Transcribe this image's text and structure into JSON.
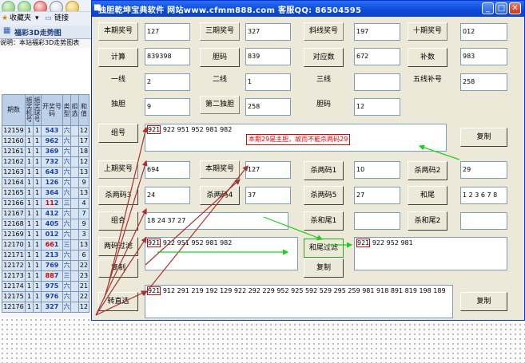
{
  "browser": {
    "favorites_label": "收藏夹",
    "links_label": "链接",
    "tab_title": "福彩3D走势图",
    "description": "说明：本站福彩3D走势图表"
  },
  "table": {
    "headers": [
      "期数",
      "摇奖机号",
      "摇奖球号",
      "开奖号码",
      "类型",
      "组选",
      "和值"
    ],
    "rows": [
      {
        "issue": "12159",
        "machine": "1",
        "ball": "1",
        "d1": "5",
        "d2": "4",
        "d3": "3",
        "type": "六",
        "sum": "12"
      },
      {
        "issue": "12160",
        "machine": "1",
        "ball": "1",
        "d1": "9",
        "d2": "6",
        "d3": "2",
        "type": "六",
        "sum": "17"
      },
      {
        "issue": "12161",
        "machine": "1",
        "ball": "1",
        "d1": "3",
        "d2": "6",
        "d3": "9",
        "type": "六",
        "sum": "18"
      },
      {
        "issue": "12162",
        "machine": "1",
        "ball": "1",
        "d1": "7",
        "d2": "3",
        "d3": "2",
        "type": "六",
        "sum": "12"
      },
      {
        "issue": "12163",
        "machine": "1",
        "ball": "1",
        "d1": "6",
        "d2": "4",
        "d3": "3",
        "type": "六",
        "sum": "13"
      },
      {
        "issue": "12164",
        "machine": "1",
        "ball": "1",
        "d1": "1",
        "d2": "2",
        "d3": "6",
        "type": "六",
        "sum": "9"
      },
      {
        "issue": "12165",
        "machine": "1",
        "ball": "1",
        "d1": "3",
        "d2": "6",
        "d3": "4",
        "type": "六",
        "sum": "13"
      },
      {
        "issue": "12166",
        "machine": "1",
        "ball": "1",
        "d1": "1",
        "d2": "1",
        "d3": "2",
        "type": "三",
        "sum": "4"
      },
      {
        "issue": "12167",
        "machine": "1",
        "ball": "1",
        "d1": "4",
        "d2": "1",
        "d3": "2",
        "type": "六",
        "sum": "7"
      },
      {
        "issue": "12168",
        "machine": "1",
        "ball": "1",
        "d1": "4",
        "d2": "0",
        "d3": "5",
        "type": "六",
        "sum": "9"
      },
      {
        "issue": "12169",
        "machine": "1",
        "ball": "1",
        "d1": "0",
        "d2": "1",
        "d3": "2",
        "type": "六",
        "sum": "3"
      },
      {
        "issue": "12170",
        "machine": "1",
        "ball": "1",
        "d1": "6",
        "d2": "6",
        "d3": "1",
        "type": "三",
        "sum": "13"
      },
      {
        "issue": "12171",
        "machine": "1",
        "ball": "1",
        "d1": "2",
        "d2": "1",
        "d3": "3",
        "type": "六",
        "sum": "6"
      },
      {
        "issue": "12172",
        "machine": "1",
        "ball": "1",
        "d1": "7",
        "d2": "6",
        "d3": "9",
        "type": "六",
        "sum": "22"
      },
      {
        "issue": "12173",
        "machine": "1",
        "ball": "1",
        "d1": "8",
        "d2": "8",
        "d3": "7",
        "type": "三",
        "sum": "23"
      },
      {
        "issue": "12174",
        "machine": "1",
        "ball": "1",
        "d1": "9",
        "d2": "7",
        "d3": "5",
        "type": "六",
        "sum": "21"
      },
      {
        "issue": "12175",
        "machine": "1",
        "ball": "1",
        "d1": "9",
        "d2": "7",
        "d3": "6",
        "type": "六",
        "sum": "22"
      },
      {
        "issue": "12176",
        "machine": "1",
        "ball": "1",
        "d1": "3",
        "d2": "2",
        "d3": "7",
        "type": "六",
        "sum": "12"
      }
    ]
  },
  "window": {
    "title": "独胆乾坤宝典软件    网站www.cfmm888.com    客服QQ: 86504595"
  },
  "labels": {
    "last_issue": "本期奖号",
    "third_issue": "三期奖号",
    "diagonal": "斜线奖号",
    "tenth_issue": "十期奖号",
    "yixian": "一线",
    "erxian": "二线",
    "sanxian": "三线",
    "wuxian_bu": "五线补号",
    "dudan": "独胆",
    "second_dudan": "第二独胆",
    "danma": "胆码",
    "prev_issue": "上期奖号",
    "current_issue": "本期奖号"
  },
  "buttons": {
    "calc": "计算",
    "danma": "胆码",
    "duizhao": "对应数",
    "bushu": "补数",
    "zuhao": "组号",
    "copy": "复制",
    "kill_two_1": "杀两码1",
    "kill_two_2": "杀两码2",
    "kill_two_3": "杀两码3",
    "kill_two_4": "杀两码4",
    "kill_two_5": "杀两码5",
    "hewei": "和尾",
    "zuhe": "组合",
    "kill_hewei_1": "杀和尾1",
    "kill_hewei_2": "杀和尾2",
    "two_filter": "两码过滤",
    "hewei_filter": "和尾过滤",
    "zhuan_zhixuan": "转直选"
  },
  "values": {
    "last_issue": "127",
    "third_issue": "327",
    "diagonal": "197",
    "tenth_issue": "012",
    "calc_result": "839398",
    "danma_result": "839",
    "duizhao_result": "672",
    "bushu_result": "983",
    "yixian": "2",
    "erxian": "1",
    "sanxian": "",
    "wuxian_bu": "258",
    "dudan": "9",
    "second_dudan": "258",
    "danma": "12",
    "prev_issue": "694",
    "current_issue": "127",
    "kill_two_1": "10",
    "kill_two_2": "29",
    "kill_two_3": "24",
    "kill_two_4": "37",
    "kill_two_5": "27",
    "hewei": "1 2 3 6 7 8",
    "zuhe": "18 24 37 27",
    "kill_hewei_1": "",
    "kill_hewei_2": "",
    "zuhao_first": "921",
    "zuhao_rest": "922 951 952 981 982",
    "filter_first": "921",
    "filter_rest": "922 951 952 981 982",
    "hewei_first": "921",
    "hewei_rest": "922 952 981",
    "zhixuan_first": "921",
    "zhixuan_rest": "912 291 219 192 129 922 292 229 952 925 592 529 295 259 981 918 891 819 198 189"
  },
  "note": "本期29是主胆，故而不能杀两码29",
  "colors": {
    "accent_red": "#dd0000",
    "arrow_green": "#22cc22",
    "arrow_brown": "#a83232",
    "title_blue": "#0a4ad8"
  }
}
